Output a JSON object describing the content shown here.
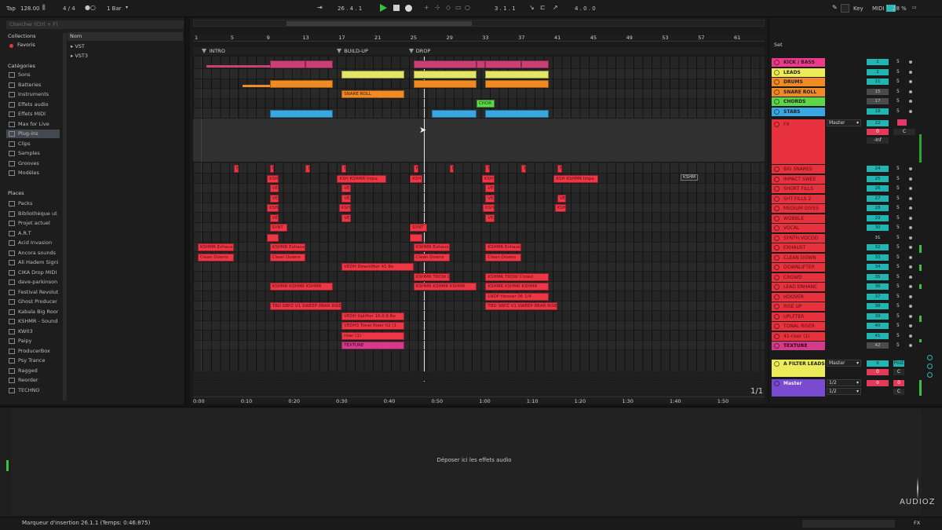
{
  "topbar": {
    "tap": "Tap",
    "tempo": "128.00",
    "signature": "4 / 4",
    "quantize": "1 Bar",
    "position": "26 .  4 .  1",
    "loop_start": "3 .  1 .  1",
    "loop_length": "4 .  0 .  0",
    "key": "Key",
    "midi": "MIDI",
    "cpu": "28 %",
    "h": "H",
    "w": "W"
  },
  "browser": {
    "search_placeholder": "Chercher (Ctrl + F)",
    "collections_header": "Collections",
    "favorites": "Favoris",
    "categories_header": "Catégories",
    "categories": [
      "Sons",
      "Batteries",
      "Instruments",
      "Effets audio",
      "Effets MIDI",
      "Max for Live",
      "Plug-ins",
      "Clips",
      "Samples",
      "Grooves",
      "Modèles"
    ],
    "selected_category": 6,
    "places_header": "Places",
    "places": [
      "Packs",
      "Bibliothèque ut",
      "Projet actuel",
      "A.R.T",
      "Acid Invasion",
      "Ancora sounds",
      "Ali Hadem Signi",
      "CIKA Drop MIDI",
      "dave-parkinson",
      "Festival Revolut",
      "Ghost Producer",
      "Kabala Big Roor",
      "KSHMR - Sound",
      "KW03",
      "Paipy",
      "ProducerBox",
      "Psy Trance",
      "Ragged",
      "Reorder",
      "TECHNO"
    ],
    "name_header": "Nom",
    "folders": [
      "VST",
      "VST3"
    ]
  },
  "arrangement": {
    "bar_numbers": [
      "1",
      "5",
      "9",
      "13",
      "17",
      "21",
      "25",
      "29",
      "33",
      "37",
      "41",
      "45",
      "49",
      "53",
      "57",
      "61"
    ],
    "locators": [
      {
        "label": "INTRO",
        "bar": 2
      },
      {
        "label": "BUILD-UP",
        "bar": 17
      },
      {
        "label": "DROP",
        "bar": 25
      }
    ],
    "time_labels": [
      "0:00",
      "0:10",
      "0:20",
      "0:30",
      "0:40",
      "0:50",
      "1:00",
      "1:10",
      "1:20",
      "1:30",
      "1:40",
      "1:50"
    ],
    "page_count": "1/1",
    "floating_tag": "KSHM",
    "clips": [
      {
        "lane": 0,
        "start": 2,
        "end": 9,
        "color": "pink",
        "label": "",
        "thin": true
      },
      {
        "lane": 0,
        "start": 9,
        "end": 13,
        "color": "pink",
        "label": ""
      },
      {
        "lane": 0,
        "start": 13,
        "end": 16,
        "color": "pink",
        "label": ""
      },
      {
        "lane": 0,
        "start": 25,
        "end": 32,
        "color": "pink",
        "label": ""
      },
      {
        "lane": 0,
        "start": 32,
        "end": 33,
        "color": "pink",
        "label": ""
      },
      {
        "lane": 0,
        "start": 33,
        "end": 37,
        "color": "pink",
        "label": ""
      },
      {
        "lane": 0,
        "start": 37,
        "end": 40,
        "color": "pink",
        "label": ""
      },
      {
        "lane": 1,
        "start": 17,
        "end": 24,
        "color": "yellow",
        "label": ""
      },
      {
        "lane": 1,
        "start": 25,
        "end": 32,
        "color": "yellow",
        "label": ""
      },
      {
        "lane": 1,
        "start": 33,
        "end": 40,
        "color": "yellow",
        "label": ""
      },
      {
        "lane": 2,
        "start": 6,
        "end": 9,
        "color": "orange",
        "label": "",
        "thin": true
      },
      {
        "lane": 2,
        "start": 9,
        "end": 16,
        "color": "orange",
        "label": ""
      },
      {
        "lane": 2,
        "start": 25,
        "end": 32,
        "color": "orange",
        "label": ""
      },
      {
        "lane": 2,
        "start": 33,
        "end": 40,
        "color": "orange",
        "label": ""
      },
      {
        "lane": 3,
        "start": 17,
        "end": 24,
        "color": "orange",
        "label": "SNARE ROLL"
      },
      {
        "lane": 4,
        "start": 32,
        "end": 34,
        "color": "green",
        "label": "CHOR"
      },
      {
        "lane": 5,
        "start": 9,
        "end": 16,
        "color": "blue",
        "label": ""
      },
      {
        "lane": 5,
        "start": 27,
        "end": 32,
        "color": "blue",
        "label": ""
      },
      {
        "lane": 5,
        "start": 33,
        "end": 40,
        "color": "blue",
        "label": ""
      },
      {
        "lane": 7,
        "start": 5,
        "end": 5.5,
        "color": "red",
        "label": "F"
      },
      {
        "lane": 7,
        "start": 9,
        "end": 9.5,
        "color": "red",
        "label": "F"
      },
      {
        "lane": 7,
        "start": 13,
        "end": 13.5,
        "color": "red",
        "label": "F"
      },
      {
        "lane": 7,
        "start": 17,
        "end": 17.5,
        "color": "red",
        "label": "F"
      },
      {
        "lane": 7,
        "start": 25,
        "end": 25.5,
        "color": "red",
        "label": "F"
      },
      {
        "lane": 7,
        "start": 29,
        "end": 29.5,
        "color": "red",
        "label": "F"
      },
      {
        "lane": 7,
        "start": 33,
        "end": 33.5,
        "color": "red",
        "label": "F"
      },
      {
        "lane": 7,
        "start": 37,
        "end": 37.5,
        "color": "red",
        "label": "F"
      },
      {
        "lane": 7,
        "start": 41,
        "end": 41.5,
        "color": "red",
        "label": "F"
      },
      {
        "lane": 8,
        "start": 8.7,
        "end": 10,
        "color": "red",
        "label": "KSH"
      },
      {
        "lane": 8,
        "start": 16.5,
        "end": 22,
        "color": "red",
        "label": "KSH  KSHMR Impa"
      },
      {
        "lane": 8,
        "start": 24.6,
        "end": 26,
        "color": "red",
        "label": "KSH"
      },
      {
        "lane": 8,
        "start": 32.6,
        "end": 34,
        "color": "red",
        "label": "KSH"
      },
      {
        "lane": 8,
        "start": 40.6,
        "end": 45.5,
        "color": "red",
        "label": "KSH  KSHMR Impa"
      },
      {
        "lane": 9,
        "start": 9,
        "end": 10,
        "color": "red",
        "label": "VE"
      },
      {
        "lane": 9,
        "start": 17,
        "end": 18,
        "color": "red",
        "label": "VE"
      },
      {
        "lane": 9,
        "start": 33,
        "end": 34,
        "color": "red",
        "label": "VE"
      },
      {
        "lane": 10,
        "start": 9,
        "end": 10,
        "color": "red",
        "label": "VE"
      },
      {
        "lane": 10,
        "start": 17,
        "end": 18,
        "color": "red",
        "label": "VE"
      },
      {
        "lane": 10,
        "start": 33,
        "end": 34,
        "color": "red",
        "label": "VE"
      },
      {
        "lane": 10,
        "start": 41,
        "end": 42,
        "color": "red",
        "label": "VE"
      },
      {
        "lane": 11,
        "start": 8.7,
        "end": 10,
        "color": "red",
        "label": "KSH"
      },
      {
        "lane": 11,
        "start": 16.7,
        "end": 18,
        "color": "red",
        "label": "KSH"
      },
      {
        "lane": 11,
        "start": 32.7,
        "end": 34,
        "color": "red",
        "label": "KSH"
      },
      {
        "lane": 11,
        "start": 40.7,
        "end": 42,
        "color": "red",
        "label": "KSH"
      },
      {
        "lane": 12,
        "start": 9,
        "end": 10,
        "color": "red",
        "label": "VE"
      },
      {
        "lane": 12,
        "start": 17,
        "end": 18,
        "color": "red",
        "label": "VE"
      },
      {
        "lane": 12,
        "start": 33,
        "end": 34,
        "color": "red",
        "label": "VE"
      },
      {
        "lane": 13,
        "start": 9,
        "end": 11,
        "color": "red",
        "label": "SYNT"
      },
      {
        "lane": 13,
        "start": 24.6,
        "end": 26.5,
        "color": "red",
        "label": "SYNT"
      },
      {
        "lane": 14,
        "start": 8.7,
        "end": 10,
        "color": "red",
        "label": ""
      },
      {
        "lane": 14,
        "start": 24.6,
        "end": 26,
        "color": "red",
        "label": ""
      },
      {
        "lane": 15,
        "start": 1,
        "end": 5,
        "color": "red",
        "label": "KSHMR  Exhaus"
      },
      {
        "lane": 15,
        "start": 9,
        "end": 13,
        "color": "red",
        "label": "KSHMR  Exhaus"
      },
      {
        "lane": 15,
        "start": 25,
        "end": 29,
        "color": "red",
        "label": "KSHMR  Exhaus"
      },
      {
        "lane": 15,
        "start": 33,
        "end": 37,
        "color": "red",
        "label": "KSHMR  Exhaus"
      },
      {
        "lane": 16,
        "start": 1,
        "end": 5,
        "color": "red",
        "label": "Clean Downs"
      },
      {
        "lane": 16,
        "start": 9,
        "end": 13,
        "color": "red",
        "label": "Clean Downs"
      },
      {
        "lane": 16,
        "start": 25,
        "end": 29,
        "color": "red",
        "label": "Clean Downs"
      },
      {
        "lane": 16,
        "start": 33,
        "end": 37,
        "color": "red",
        "label": "Clean Downs"
      },
      {
        "lane": 17,
        "start": 17,
        "end": 25,
        "color": "red",
        "label": "VEDH  Downlifter  41 Be"
      },
      {
        "lane": 18,
        "start": 25,
        "end": 29,
        "color": "red",
        "label": "KSHMR  TROW  Crowd"
      },
      {
        "lane": 18,
        "start": 33,
        "end": 40,
        "color": "red",
        "label": "KSHMR  TROW  Crowd"
      },
      {
        "lane": 19,
        "start": 9,
        "end": 16,
        "color": "red",
        "label": "KSHMR  KSHMR  KSHMR"
      },
      {
        "lane": 19,
        "start": 25,
        "end": 32,
        "color": "red",
        "label": "KSHMR  KSHMR  KSHMR"
      },
      {
        "lane": 19,
        "start": 33,
        "end": 40,
        "color": "red",
        "label": "KSHMR  KSHMR  KSHMR"
      },
      {
        "lane": 20,
        "start": 33,
        "end": 40,
        "color": "red",
        "label": "LNDP  Hoover  06  1/4"
      },
      {
        "lane": 21,
        "start": 9,
        "end": 17,
        "color": "red",
        "label": "TBD  SBPZ  V1  SWEEP  8BAR  RISE"
      },
      {
        "lane": 21,
        "start": 33,
        "end": 41,
        "color": "red",
        "label": "TBD  SBPZ  V1  SWEEP  8BAR  RISE"
      },
      {
        "lane": 22,
        "start": 17,
        "end": 24,
        "color": "red",
        "label": "VEDH  Uplifter  16.0.8 Be"
      },
      {
        "lane": 23,
        "start": 17,
        "end": 24,
        "color": "red",
        "label": "VEDH3  Tonal Riser 02 (1"
      },
      {
        "lane": 24,
        "start": 17,
        "end": 24,
        "color": "red",
        "label": "riser (1)"
      },
      {
        "lane": 25,
        "start": 17,
        "end": 24,
        "color": "mag",
        "label": "TEXTURE"
      }
    ]
  },
  "tracks": {
    "set_label": "Set",
    "list": [
      {
        "name": "KICK / BASS",
        "color": "#ee3a8a",
        "vol": "1",
        "send": "5",
        "row": 0
      },
      {
        "name": "LEADS",
        "color": "#ecec5a",
        "vol": "2",
        "send": "5",
        "row": 1
      },
      {
        "name": "DRUMS",
        "color": "#f08a24",
        "vol": "11",
        "send": "5",
        "row": 2
      },
      {
        "name": "SNARE ROLL",
        "color": "#f08a24",
        "vol": "15",
        "send": "5",
        "row": 3,
        "grey": true
      },
      {
        "name": "CHORDS",
        "color": "#5dd64a",
        "vol": "17",
        "send": "5",
        "row": 4,
        "grey": true
      },
      {
        "name": "STABS",
        "color": "#3aa7e0",
        "vol": "18",
        "send": "5",
        "row": 5
      }
    ],
    "fx": {
      "name": "FX",
      "routing": "Master",
      "vol": "22",
      "pan": "0",
      "c": "C",
      "db": "-Inf"
    },
    "sub": [
      {
        "name": "BIG SNARES",
        "vol": "24",
        "send": "5"
      },
      {
        "name": "IMPACT SWEE",
        "vol": "25",
        "send": "5"
      },
      {
        "name": "SHORT FILLS",
        "vol": "26",
        "send": "5"
      },
      {
        "name": "SHT FILLS 2",
        "vol": "27",
        "send": "5"
      },
      {
        "name": "MEDIUM DIVES",
        "vol": "28",
        "send": "5"
      },
      {
        "name": "WOBBLE",
        "vol": "29",
        "send": "5"
      },
      {
        "name": "VOCAL",
        "vol": "30",
        "send": "5"
      },
      {
        "name": "SYNTH VOCOD",
        "vol": "31",
        "send": "5"
      },
      {
        "name": "EXHAUST",
        "vol": "32",
        "send": "5"
      },
      {
        "name": "CLEAN DOWN",
        "vol": "33",
        "send": "5"
      },
      {
        "name": "DOWNLIFTER",
        "vol": "34",
        "send": "5"
      },
      {
        "name": "CROWD",
        "vol": "35",
        "send": "5"
      },
      {
        "name": "LEAD ENHANC",
        "vol": "36",
        "send": "5"
      },
      {
        "name": "HOOVER",
        "vol": "37",
        "send": "5"
      },
      {
        "name": "RISE UP",
        "vol": "38",
        "send": "5"
      },
      {
        "name": "UPLFTER",
        "vol": "39",
        "send": "5"
      },
      {
        "name": "TONAL RISER",
        "vol": "40",
        "send": "5"
      },
      {
        "name": "41-riser (1)",
        "vol": "41",
        "send": "5"
      }
    ],
    "texture": {
      "name": "TEXTURE",
      "vol": "42",
      "send": "5"
    },
    "return": {
      "name": "A FILTER LEADS",
      "routing": "Master",
      "vol": "0",
      "send": "Post",
      "pan": "0",
      "c": "C"
    },
    "master": {
      "name": "Master",
      "cue": "1/2",
      "out": "1/2",
      "vol": "0",
      "pan": "0",
      "c": "C"
    }
  },
  "device": {
    "drop_hint": "Déposer ici les effets audio"
  },
  "status": {
    "text": "Marqueur d'insertion 26.1.1 (Temps: 0:46:875)",
    "fx": "FX"
  },
  "watermark": {
    "text": "AUDIOZ"
  }
}
